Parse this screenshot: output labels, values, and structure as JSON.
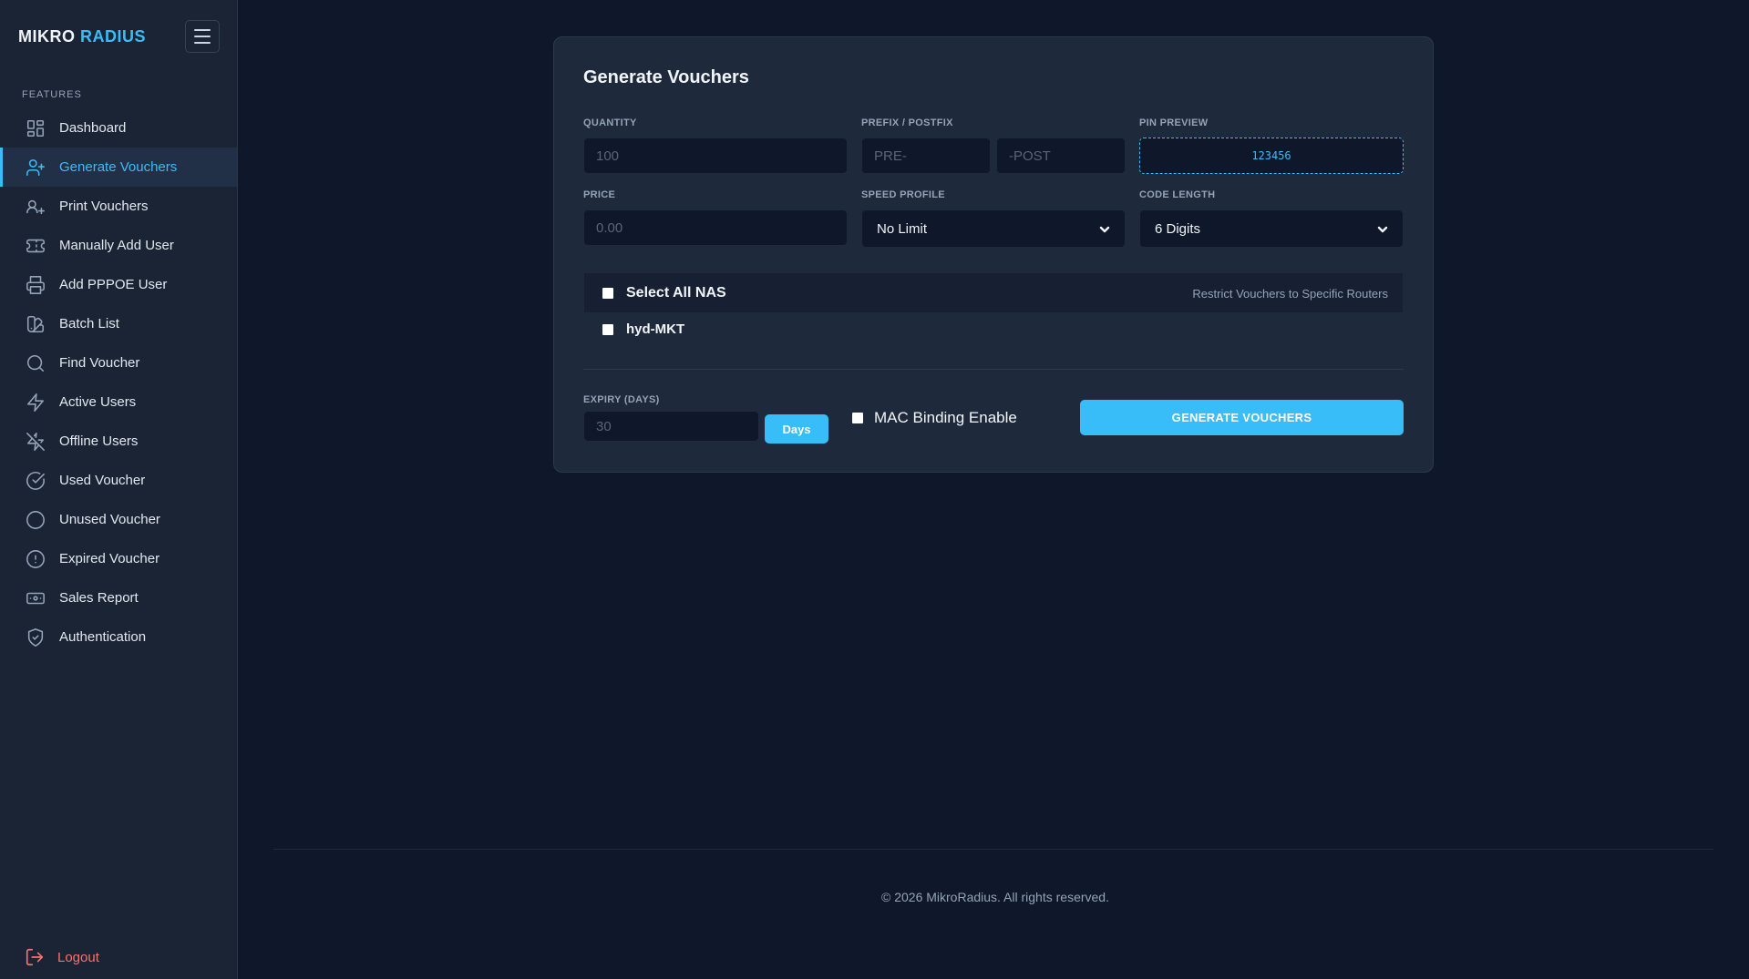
{
  "brand": {
    "part1": "MIKRO",
    "part2": "RADIUS"
  },
  "sidebar": {
    "section_label": "FEATURES",
    "items": [
      {
        "label": "Dashboard",
        "icon": "grid-icon"
      },
      {
        "label": "Generate Vouchers",
        "icon": "user-plus-icon",
        "active": true
      },
      {
        "label": "Print Vouchers",
        "icon": "user-plus-icon"
      },
      {
        "label": "Manually Add User",
        "icon": "ticket-icon"
      },
      {
        "label": "Add PPPOE User",
        "icon": "printer-icon"
      },
      {
        "label": "Batch List",
        "icon": "swatch-book-icon"
      },
      {
        "label": "Find Voucher",
        "icon": "search-icon"
      },
      {
        "label": "Active Users",
        "icon": "zap-icon"
      },
      {
        "label": "Offline Users",
        "icon": "zap-off-icon"
      },
      {
        "label": "Used Voucher",
        "icon": "check-circle-icon"
      },
      {
        "label": "Unused Voucher",
        "icon": "circle-icon"
      },
      {
        "label": "Expired Voucher",
        "icon": "alert-circle-icon"
      },
      {
        "label": "Sales Report",
        "icon": "banknote-icon"
      },
      {
        "label": "Authentication",
        "icon": "shield-check-icon"
      }
    ],
    "logout_label": "Logout"
  },
  "form": {
    "title": "Generate Vouchers",
    "quantity_label": "QUANTITY",
    "quantity_placeholder": "100",
    "prefix_label": "PREFIX / POSTFIX",
    "prefix_placeholder": "PRE-",
    "postfix_placeholder": "-POST",
    "pin_preview_label": "PIN PREVIEW",
    "pin_preview_value": "123456",
    "price_label": "PRICE",
    "price_placeholder": "0.00",
    "speed_profile_label": "SPEED PROFILE",
    "speed_profile_value": "No Limit",
    "code_length_label": "CODE LENGTH",
    "code_length_value": "6 Digits",
    "select_all_nas_label": "Select All NAS",
    "nas_note": "Restrict Vouchers to Specific Routers",
    "nas_items": [
      {
        "label": "hyd-MKT"
      }
    ],
    "expiry_label": "EXPIRY (DAYS)",
    "expiry_placeholder": "30",
    "days_button": "Days",
    "mac_binding_label": "MAC Binding Enable",
    "generate_button": "GENERATE VOUCHERS"
  },
  "footer": {
    "copyright": "© 2026 MikroRadius. All rights reserved."
  },
  "colors": {
    "accent": "#38bdf8",
    "background": "#0f172a",
    "sidebar": "#1b2435",
    "card": "#1e293b",
    "danger": "#f87171"
  }
}
